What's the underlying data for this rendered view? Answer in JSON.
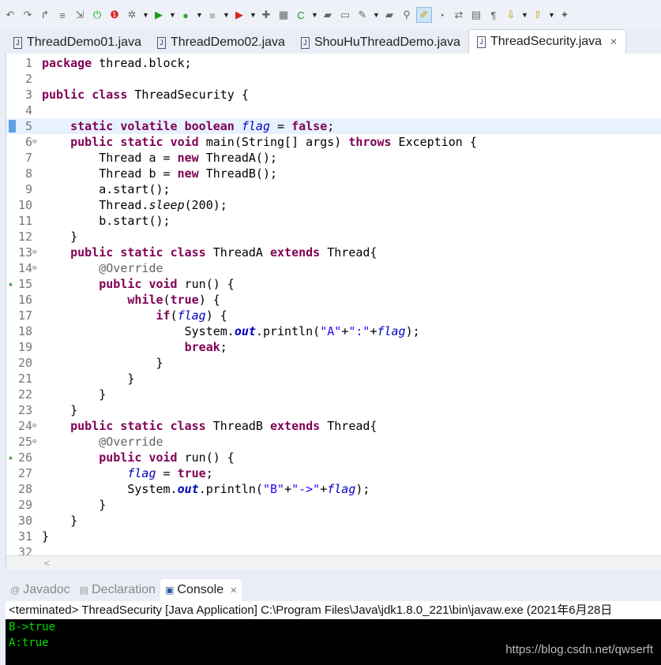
{
  "toolbar": {
    "icons": [
      "undo-icon",
      "redo-icon",
      "forward-icon",
      "skip-icon",
      "step-return-icon",
      "power-icon",
      "error-badge-icon",
      "debug-icon",
      "run-icon",
      "run-server-icon",
      "stop-icon",
      "external-run-icon",
      "new-java-icon",
      "package-icon",
      "new-class-icon",
      "open-folder-icon",
      "open-type-icon",
      "pen-icon",
      "open-task-icon",
      "search-icon",
      "highlight-icon",
      "toggle-icon",
      "refactor-icon",
      "block-icon",
      "pilcrow-icon",
      "next-annotation-icon",
      "prev-annotation-icon",
      "pin-icon"
    ]
  },
  "tabs": [
    {
      "label": "ThreadDemo01.java"
    },
    {
      "label": "ThreadDemo02.java"
    },
    {
      "label": "ShouHuThreadDemo.java"
    },
    {
      "label": "ThreadSecurity.java",
      "active": true
    }
  ],
  "editor": {
    "current_line": 5,
    "lines": [
      [
        [
          "package",
          "k"
        ],
        [
          " thread.block;",
          ""
        ]
      ],
      [],
      [
        [
          "public",
          "k"
        ],
        [
          " ",
          ""
        ],
        [
          "class",
          "k"
        ],
        [
          " ThreadSecurity {",
          ""
        ]
      ],
      [],
      [
        [
          "    ",
          ""
        ],
        [
          "static",
          "k"
        ],
        [
          " ",
          ""
        ],
        [
          "volatile",
          "k"
        ],
        [
          " ",
          ""
        ],
        [
          "boolean",
          "k"
        ],
        [
          " ",
          ""
        ],
        [
          "flag",
          "f"
        ],
        [
          " = ",
          ""
        ],
        [
          "false",
          "k"
        ],
        [
          ";",
          ""
        ]
      ],
      [
        [
          "    ",
          ""
        ],
        [
          "public",
          "k"
        ],
        [
          " ",
          ""
        ],
        [
          "static",
          "k"
        ],
        [
          " ",
          ""
        ],
        [
          "void",
          "k"
        ],
        [
          " main(String[] args) ",
          ""
        ],
        [
          "throws",
          "k"
        ],
        [
          " Exception {",
          ""
        ]
      ],
      [
        [
          "        Thread a = ",
          ""
        ],
        [
          "new",
          "k"
        ],
        [
          " ThreadA();",
          ""
        ]
      ],
      [
        [
          "        Thread b = ",
          ""
        ],
        [
          "new",
          "k"
        ],
        [
          " ThreadB();",
          ""
        ]
      ],
      [
        [
          "        a.start();",
          ""
        ]
      ],
      [
        [
          "        Thread.",
          ""
        ],
        [
          "sleep",
          "m"
        ],
        [
          "(200);",
          ""
        ]
      ],
      [
        [
          "        b.start();",
          ""
        ]
      ],
      [
        [
          "    }",
          ""
        ]
      ],
      [
        [
          "    ",
          ""
        ],
        [
          "public",
          "k"
        ],
        [
          " ",
          ""
        ],
        [
          "static",
          "k"
        ],
        [
          " ",
          ""
        ],
        [
          "class",
          "k"
        ],
        [
          " ThreadA ",
          ""
        ],
        [
          "extends",
          "k"
        ],
        [
          " Thread{",
          ""
        ]
      ],
      [
        [
          "        ",
          ""
        ],
        [
          "@Override",
          "a"
        ]
      ],
      [
        [
          "        ",
          ""
        ],
        [
          "public",
          "k"
        ],
        [
          " ",
          ""
        ],
        [
          "void",
          "k"
        ],
        [
          " run() {",
          ""
        ]
      ],
      [
        [
          "            ",
          ""
        ],
        [
          "while",
          "k"
        ],
        [
          "(",
          ""
        ],
        [
          "true",
          "k"
        ],
        [
          ") {",
          ""
        ]
      ],
      [
        [
          "                ",
          ""
        ],
        [
          "if",
          "k"
        ],
        [
          "(",
          ""
        ],
        [
          "flag",
          "f"
        ],
        [
          ") {",
          ""
        ]
      ],
      [
        [
          "                    System.",
          ""
        ],
        [
          "out",
          "o"
        ],
        [
          ".println(",
          ""
        ],
        [
          "\"A\"",
          "s"
        ],
        [
          "+",
          ""
        ],
        [
          "\":\"",
          "s"
        ],
        [
          "+",
          ""
        ],
        [
          "flag",
          "f"
        ],
        [
          ");",
          ""
        ]
      ],
      [
        [
          "                    ",
          ""
        ],
        [
          "break",
          "k"
        ],
        [
          ";",
          ""
        ]
      ],
      [
        [
          "                }",
          ""
        ]
      ],
      [
        [
          "            }",
          ""
        ]
      ],
      [
        [
          "        }",
          ""
        ]
      ],
      [
        [
          "    }",
          ""
        ]
      ],
      [
        [
          "    ",
          ""
        ],
        [
          "public",
          "k"
        ],
        [
          " ",
          ""
        ],
        [
          "static",
          "k"
        ],
        [
          " ",
          ""
        ],
        [
          "class",
          "k"
        ],
        [
          " ThreadB ",
          ""
        ],
        [
          "extends",
          "k"
        ],
        [
          " Thread{",
          ""
        ]
      ],
      [
        [
          "        ",
          ""
        ],
        [
          "@Override",
          "a"
        ]
      ],
      [
        [
          "        ",
          ""
        ],
        [
          "public",
          "k"
        ],
        [
          " ",
          ""
        ],
        [
          "void",
          "k"
        ],
        [
          " run() {",
          ""
        ]
      ],
      [
        [
          "            ",
          ""
        ],
        [
          "flag",
          "f"
        ],
        [
          " = ",
          ""
        ],
        [
          "true",
          "k"
        ],
        [
          ";",
          ""
        ]
      ],
      [
        [
          "            System.",
          ""
        ],
        [
          "out",
          "o"
        ],
        [
          ".println(",
          ""
        ],
        [
          "\"B\"",
          "s"
        ],
        [
          "+",
          ""
        ],
        [
          "\"->\"",
          "s"
        ],
        [
          "+",
          ""
        ],
        [
          "flag",
          "f"
        ],
        [
          ");",
          ""
        ]
      ],
      [
        [
          "        }",
          ""
        ]
      ],
      [
        [
          "    }",
          ""
        ]
      ],
      [
        [
          "}",
          ""
        ]
      ],
      []
    ],
    "fold_lines": [
      6,
      13,
      14,
      24,
      25
    ],
    "override_lines": [
      15,
      26
    ]
  },
  "console": {
    "tabs": [
      {
        "label": "Javadoc",
        "icon": "at-icon"
      },
      {
        "label": "Declaration",
        "icon": "declaration-icon"
      },
      {
        "label": "Console",
        "icon": "console-icon",
        "active": true
      }
    ],
    "header": "<terminated> ThreadSecurity [Java Application] C:\\Program Files\\Java\\jdk1.8.0_221\\bin\\javaw.exe (2021年6月28日",
    "output": [
      "B->true",
      "A:true"
    ],
    "watermark": "https://blog.csdn.net/qwserft"
  }
}
